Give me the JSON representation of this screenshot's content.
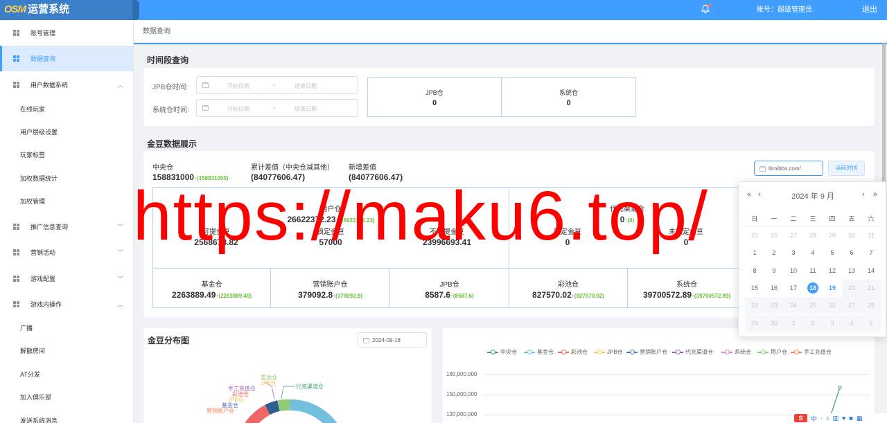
{
  "header": {
    "logo_prefix": "OSM",
    "logo_title": "运营系统",
    "account_label": "账号：超级管理员",
    "logout": "退出"
  },
  "sidebar": {
    "menu": [
      {
        "label": "账号管理",
        "active": false
      },
      {
        "label": "数据查询",
        "active": true
      },
      {
        "label": "用户数据系统",
        "expanded": true,
        "children": [
          "在线玩家",
          "用户层级设置",
          "玩家标签",
          "加权数据统计",
          "加权管理"
        ]
      },
      {
        "label": "推广信息查询",
        "expanded": false
      },
      {
        "label": "营销活动",
        "expanded": false
      },
      {
        "label": "游戏配置",
        "expanded": false
      },
      {
        "label": "游戏内操作",
        "expanded": true,
        "children": [
          "广播",
          "解散房间",
          "AT分发",
          "加入俱乐部",
          "发送系统消息"
        ]
      }
    ]
  },
  "breadcrumb": "数据查询",
  "period": {
    "title": "时间段查询",
    "jpb_label": "JPB仓时间:",
    "sys_label": "系统仓时间:",
    "start_placeholder": "开始日期",
    "end_placeholder": "结束日期",
    "sep": "-",
    "boxes": [
      {
        "title": "JPB仓",
        "value": "0"
      },
      {
        "title": "系统仓",
        "value": "0"
      }
    ]
  },
  "gold": {
    "title": "金豆数据展示",
    "summary": [
      {
        "label": "中央仓",
        "value": "158831000",
        "delta": "↑(158831000)"
      },
      {
        "label": "累计差值（中央仓减其他）",
        "value": "(84077606.47)"
      },
      {
        "label": "新增差值",
        "value": "(84077606.47)"
      }
    ],
    "date_value": "ltimibbs.com/",
    "now_button": "当前时间",
    "groups": [
      {
        "title": "用户仓",
        "value": "26622372.23",
        "delta": "↑(26622372.23)"
      },
      {
        "title": "代充渠道仓",
        "value": "0",
        "delta": "↑(0)"
      }
    ],
    "subs": [
      {
        "title": "可提金豆",
        "value": "2568678.82"
      },
      {
        "title": "锁定金豆",
        "value": "57000"
      },
      {
        "title": "不可提金豆",
        "value": "23996693.41"
      },
      {
        "title": "锁定金豆",
        "value": "0"
      },
      {
        "title": "未锁定金豆",
        "value": "0"
      }
    ],
    "row2": [
      {
        "title": "基金仓",
        "value": "2263889.49",
        "delta": "↑(2263889.49)"
      },
      {
        "title": "营销账户仓",
        "value": "379092.8",
        "delta": "↑(379092.8)"
      },
      {
        "title": "JPB仓",
        "value": "8587.6",
        "delta": "↑(8587.6)"
      },
      {
        "title": "彩池仓",
        "value": "827570.02",
        "delta": "↑(827570.02)"
      },
      {
        "title": "系统仓",
        "value": "39700572.89",
        "delta": "↑(39700572.89)"
      }
    ]
  },
  "datepicker": {
    "title": "2024 年  9 月",
    "prev_year": "«",
    "prev_month": "‹",
    "next_month": "›",
    "next_year": "»",
    "weekdays": [
      "日",
      "一",
      "二",
      "三",
      "四",
      "五",
      "六"
    ],
    "weeks": [
      [
        "25",
        "26",
        "27",
        "28",
        "29",
        "30",
        "31"
      ],
      [
        "1",
        "2",
        "3",
        "4",
        "5",
        "6",
        "7"
      ],
      [
        "8",
        "9",
        "10",
        "11",
        "12",
        "13",
        "14"
      ],
      [
        "15",
        "16",
        "17",
        "18",
        "19",
        "20",
        "21"
      ],
      [
        "22",
        "23",
        "24",
        "25",
        "26",
        "27",
        "28"
      ],
      [
        "29",
        "30",
        "1",
        "2",
        "3",
        "4",
        "5"
      ]
    ],
    "selected": "18",
    "today": "19"
  },
  "distribution": {
    "title": "金豆分布图",
    "date": "2024-09-18",
    "pie_labels": [
      {
        "text": "奖池仓",
        "color": "#91cc75"
      },
      {
        "text": "JPB仓",
        "color": "#fac858"
      },
      {
        "text": "代充渠道仓",
        "color": "#3ba272"
      },
      {
        "text": "手工充值仓",
        "color": "#9a60b4"
      },
      {
        "text": "彩池仓",
        "color": "#ee6666"
      },
      {
        "text": "JPB仓",
        "color": "#fac858"
      },
      {
        "text": "基金仓",
        "color": "#5470c6"
      },
      {
        "text": "营销账户仓",
        "color": "#fc8452"
      }
    ]
  },
  "chart_data": {
    "type": "line",
    "legend": [
      {
        "name": "中央仓",
        "color": "#3ba272"
      },
      {
        "name": "基金仓",
        "color": "#73c0de"
      },
      {
        "name": "彩池仓",
        "color": "#ee6666"
      },
      {
        "name": "JPB仓",
        "color": "#fac858"
      },
      {
        "name": "营销账户仓",
        "color": "#5470c6"
      },
      {
        "name": "代充渠道仓",
        "color": "#9a60b4"
      },
      {
        "name": "系统仓",
        "color": "#ea7ccc"
      },
      {
        "name": "用户仓",
        "color": "#91cc75"
      },
      {
        "name": "手工充值仓",
        "color": "#fc8452"
      }
    ],
    "yticks": [
      "180,000,000",
      "150,000,000",
      "120,000,000"
    ]
  },
  "watermark": "https://maku6.top/",
  "tray": {
    "badge": "S",
    "chars": [
      "中",
      "·",
      "♪",
      "▥",
      "♥",
      "■",
      "▦"
    ]
  }
}
